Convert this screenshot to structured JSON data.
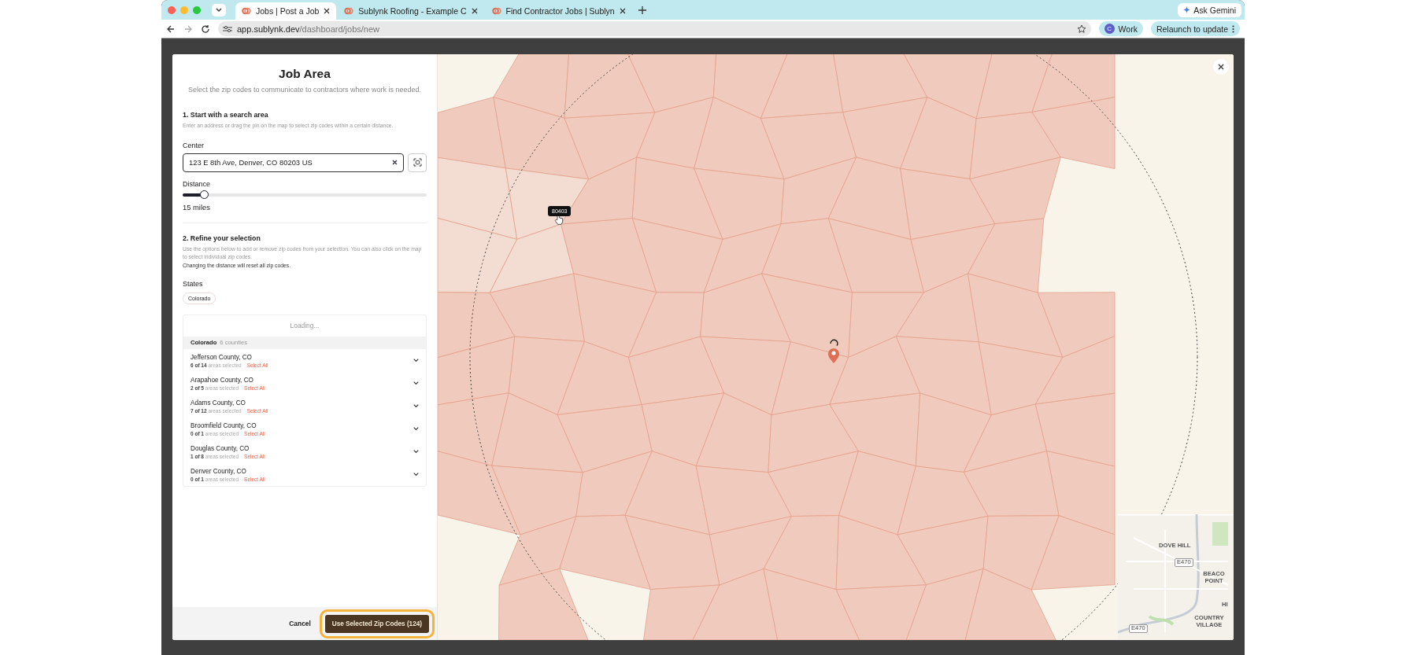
{
  "browser": {
    "tabs": [
      {
        "title": "Jobs | Post a Job",
        "selected": true
      },
      {
        "title": "Sublynk Roofing - Example C",
        "selected": false
      },
      {
        "title": "Find Contractor Jobs | Sublyn",
        "selected": false
      }
    ],
    "gemini_button": "Ask Gemini",
    "url": {
      "host": "app.sublynk.dev",
      "path": "/dashboard/jobs/new"
    },
    "profile": {
      "initial": "C",
      "label": "Work"
    },
    "relaunch_button": "Relaunch to update"
  },
  "panel": {
    "title": "Job Area",
    "subtitle": "Select the zip codes to communicate to contractors where work is needed.",
    "step1": {
      "heading": "1. Start with a search area",
      "hint": "Enter an address or drag the pin on the map to select zip codes within a certain distance."
    },
    "center": {
      "label": "Center",
      "value": "123 E 8th Ave, Denver, CO 80203 US"
    },
    "distance": {
      "label": "Distance",
      "level": 0.09,
      "reading": "15 miles"
    },
    "step2": {
      "heading": "2. Refine your selection",
      "hint": "Use the options below to add or remove zip codes from your selection. You can also click on the map to select individual zip codes.",
      "note": "Changing the distance will reset all zip codes."
    },
    "states": {
      "label": "States",
      "chips": [
        "Colorado"
      ]
    },
    "counties": {
      "status": "Loading...",
      "group": "Colorado",
      "group_count": "6 counties",
      "items": [
        {
          "name": "Jefferson County, CO",
          "count": "6 of 14",
          "suffix": "areas selected",
          "action": "Select All"
        },
        {
          "name": "Arapahoe County, CO",
          "count": "2 of 5",
          "suffix": "areas selected",
          "action": "Select All"
        },
        {
          "name": "Adams County, CO",
          "count": "7 of 12",
          "suffix": "areas selected",
          "action": "Select All"
        },
        {
          "name": "Broomfield County, CO",
          "count": "0 of 1",
          "suffix": "areas selected",
          "action": "Select All"
        },
        {
          "name": "Douglas County, CO",
          "count": "1 of 8",
          "suffix": "areas selected",
          "action": "Select All"
        },
        {
          "name": "Denver County, CO",
          "count": "0 of 1",
          "suffix": "areas selected",
          "action": "Select All"
        }
      ]
    },
    "footer": {
      "cancel": "Cancel",
      "submit": "Use Selected Zip Codes (124)",
      "submit_focused": true
    }
  },
  "map": {
    "tooltip": "80403",
    "labels": [
      {
        "text": "DOVE HILL",
        "kind": "place"
      },
      {
        "text": "E470",
        "kind": "road"
      },
      {
        "text": "BEACO POINT",
        "kind": "place"
      },
      {
        "text": "HI",
        "kind": "place"
      },
      {
        "text": "COUNTRY VILLAGE",
        "kind": "place"
      },
      {
        "text": "E470",
        "kind": "road"
      }
    ]
  }
}
